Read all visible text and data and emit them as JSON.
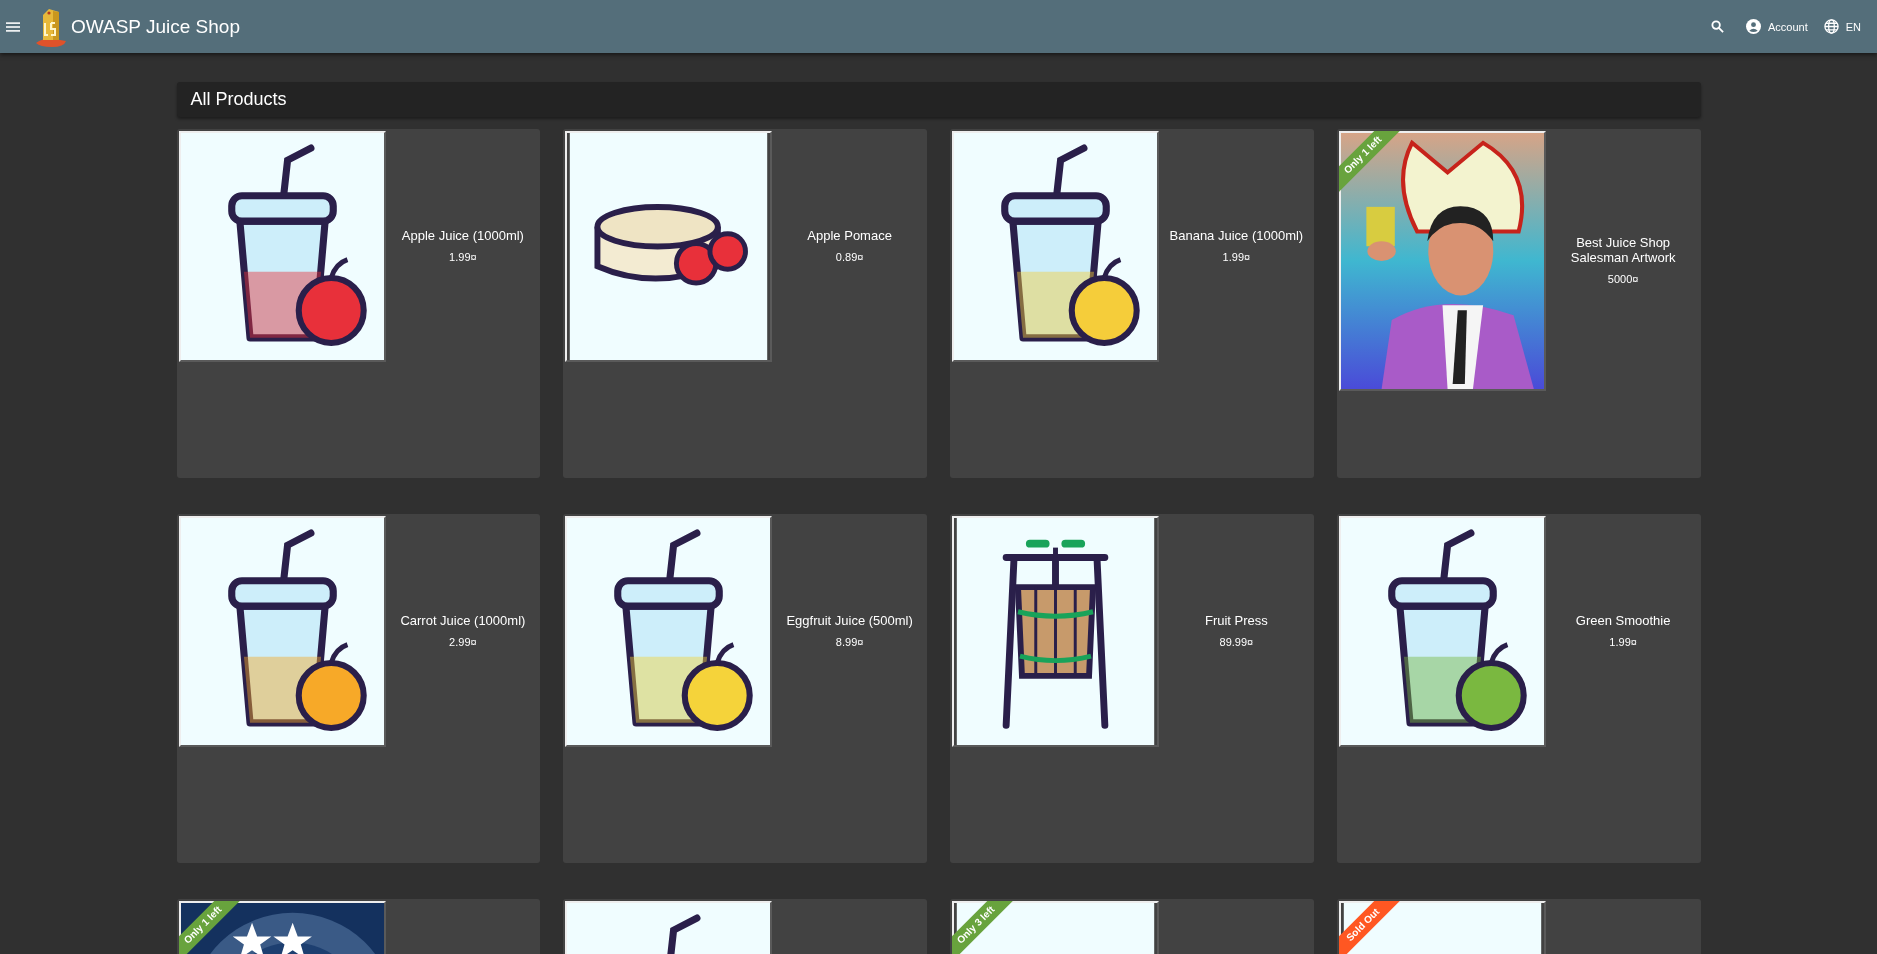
{
  "header": {
    "title": "OWASP Juice Shop",
    "account": "Account",
    "language": "EN"
  },
  "heading": "All Products",
  "products": [
    {
      "name": "Apple Juice (1000ml)",
      "price": "1.99¤",
      "image": {
        "kind": "juice",
        "color": "#e8303a"
      }
    },
    {
      "name": "Apple Pomace",
      "price": "0.89¤",
      "image": {
        "kind": "pomace",
        "color": "#e8303a"
      }
    },
    {
      "name": "Banana Juice (1000ml)",
      "price": "1.99¤",
      "image": {
        "kind": "juice",
        "color": "#f5cd3a"
      }
    },
    {
      "name": "Best Juice Shop Salesman Artwork",
      "price": "5000¤",
      "image": {
        "kind": "artwork"
      },
      "ribbon": {
        "text": "Only 1 left",
        "color": "#68a33d"
      }
    },
    {
      "name": "Carrot Juice (1000ml)",
      "price": "2.99¤",
      "image": {
        "kind": "juice",
        "color": "#f7a928"
      }
    },
    {
      "name": "Eggfruit Juice (500ml)",
      "price": "8.99¤",
      "image": {
        "kind": "juice",
        "color": "#f5d33a"
      }
    },
    {
      "name": "Fruit Press",
      "price": "89.99¤",
      "image": {
        "kind": "press"
      }
    },
    {
      "name": "Green Smoothie",
      "price": "1.99¤",
      "image": {
        "kind": "juice",
        "color": "#7ab840"
      }
    },
    {
      "ribbon": {
        "text": "Only 1 left",
        "color": "#68a33d"
      }
    },
    {
      "image": {
        "kind": "juice"
      }
    },
    {
      "image": {
        "kind": "blank"
      },
      "ribbon": {
        "text": "Only 3 left",
        "color": "#68a33d"
      }
    },
    {
      "image": {
        "kind": "blank"
      },
      "ribbon": {
        "text": "Sold Out",
        "color": "#ff5722"
      }
    }
  ]
}
